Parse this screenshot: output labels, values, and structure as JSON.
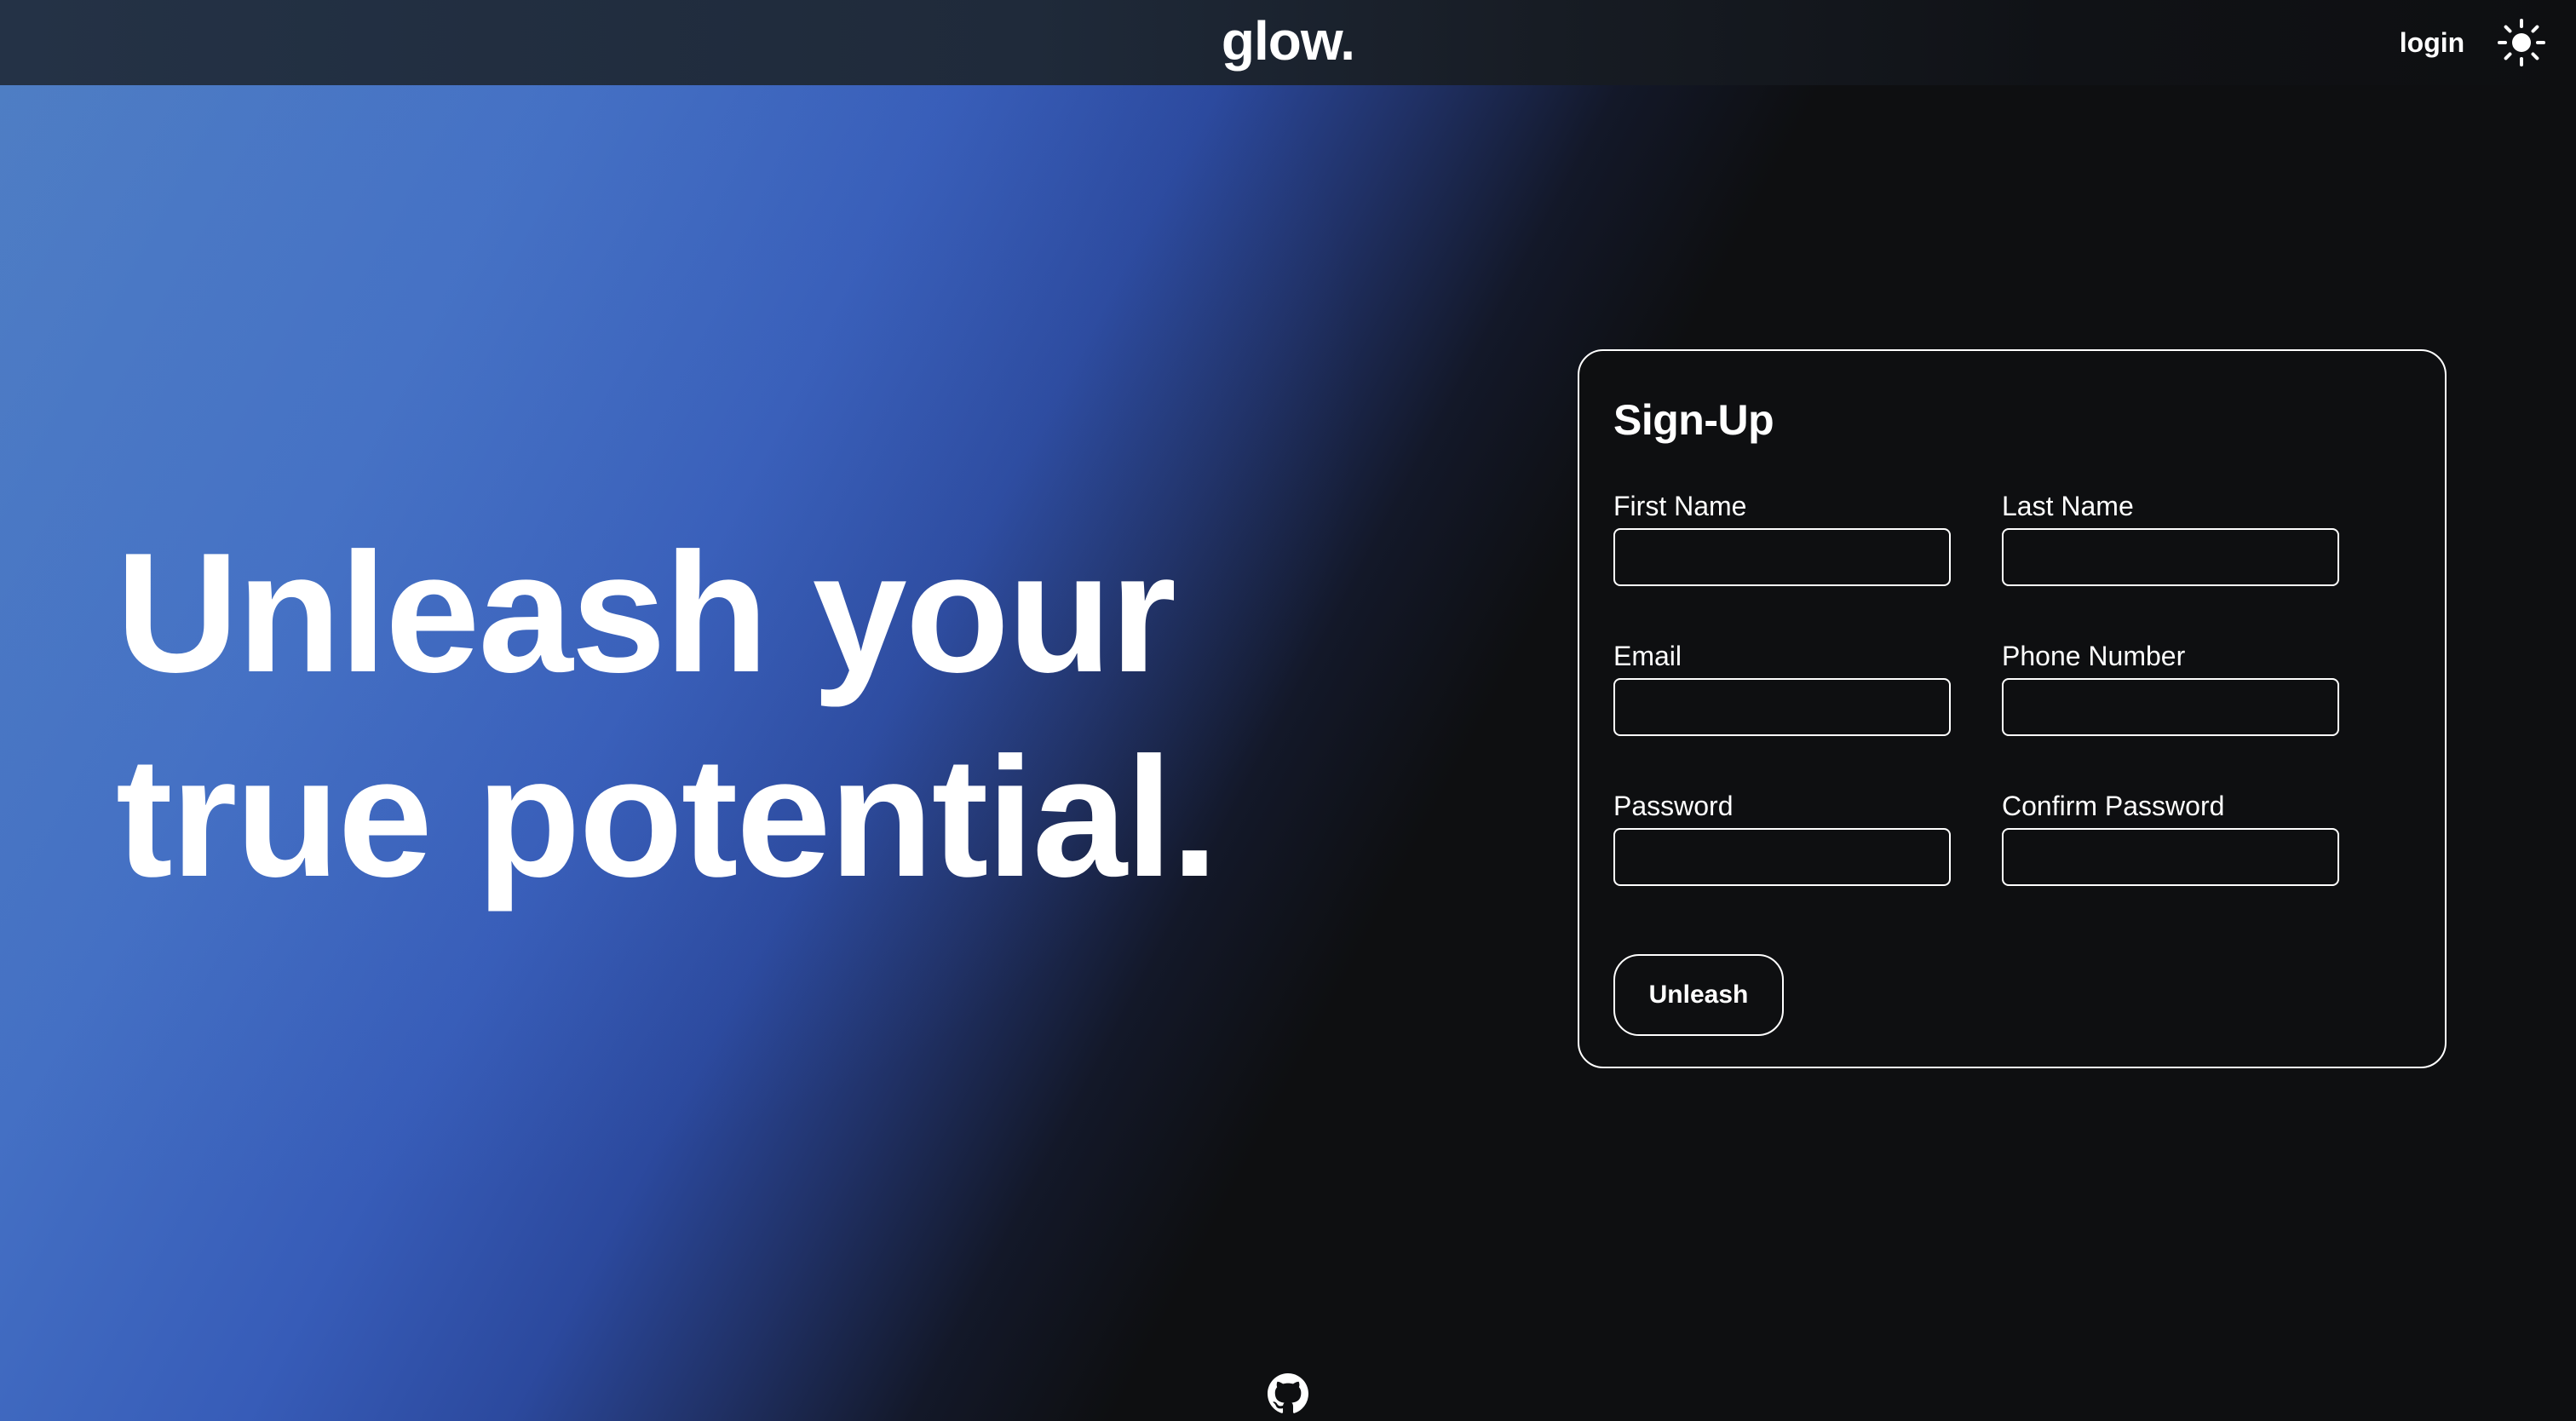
{
  "header": {
    "logo": "glow.",
    "login_label": "login",
    "theme_icon": "sun-icon"
  },
  "hero": {
    "line1": "Unleash your",
    "line2": "true potential."
  },
  "signup": {
    "title": "Sign-Up",
    "fields": {
      "first_name": {
        "label": "First Name",
        "value": "",
        "placeholder": ""
      },
      "last_name": {
        "label": "Last Name",
        "value": "",
        "placeholder": ""
      },
      "email": {
        "label": "Email",
        "value": "",
        "placeholder": ""
      },
      "phone": {
        "label": "Phone Number",
        "value": "",
        "placeholder": ""
      },
      "password": {
        "label": "Password",
        "value": "",
        "placeholder": ""
      },
      "confirm_password": {
        "label": "Confirm Password",
        "value": "",
        "placeholder": ""
      }
    },
    "submit_label": "Unleash"
  },
  "footer": {
    "github_icon": "github-icon"
  },
  "colors": {
    "background": "#0e0f11",
    "accent_blue": "#3d63bd",
    "text": "#ffffff",
    "header": "#243246"
  }
}
